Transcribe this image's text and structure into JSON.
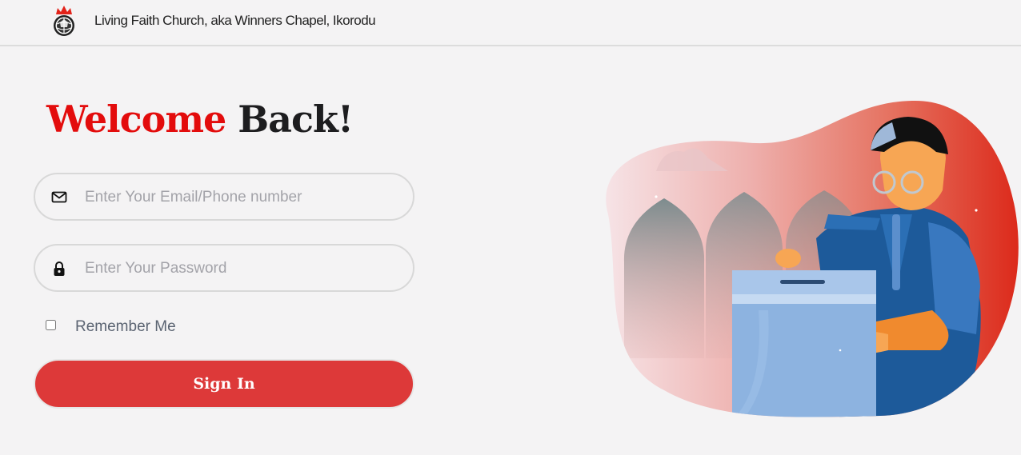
{
  "header": {
    "logo_icon": "church-logo",
    "title": "Living Faith Church, aka Winners Chapel, Ikorodu"
  },
  "welcome": {
    "highlight": "Welcome",
    "rest": "Back!",
    "highlight_color": "#e30c0c"
  },
  "form": {
    "email": {
      "icon": "envelope-icon",
      "placeholder": "Enter Your Email/Phone number",
      "value": ""
    },
    "password": {
      "icon": "lock-icon",
      "placeholder": "Enter Your Password",
      "value": ""
    },
    "remember": {
      "label": "Remember Me",
      "checked": false
    },
    "submit_label": "Sign In",
    "submit_color": "#dd3939"
  },
  "illustration": {
    "subject": "person-casting-ballot-illustration"
  }
}
